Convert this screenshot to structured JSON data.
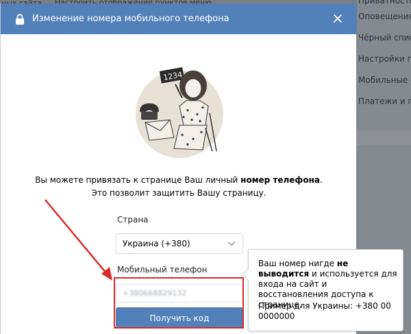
{
  "background": {
    "top_left_text": "ных сайта",
    "top_mid_text": "Настроить отображение пунктов меню",
    "right_menu": [
      "Приватность",
      "Оповещения",
      "Чёрный список",
      "Настройки при",
      "Мобильные сер",
      "Платежи и пере"
    ]
  },
  "modal": {
    "title": "Изменение номера мобильного телефона",
    "description_line1_part1": "Вы можете привязать к странице Ваш личный ",
    "description_line1_bold": "номер телефона",
    "description_line1_end": ".",
    "description_line2": "Это позволит защитить Вашу страницу.",
    "illustration_number": "1234",
    "country_label": "Страна",
    "country_value": "Украина (+380)",
    "phone_label": "Мобильный телефон",
    "phone_value": "+380668829132",
    "submit_label": "Получить код"
  },
  "tooltip": {
    "part1": "Ваш номер нигде ",
    "bold": "не выводится",
    "part2": " и используется для входа на сайт и восстановления доступа к странице.",
    "example": "Пример для Украины: +380 00 0000000"
  },
  "colors": {
    "header_blue": "#5181b8",
    "highlight_red": "#d92828",
    "overlay_gray": "#7b7f84"
  },
  "icons": [
    "lock-icon",
    "close-icon",
    "chevron-down-icon"
  ]
}
